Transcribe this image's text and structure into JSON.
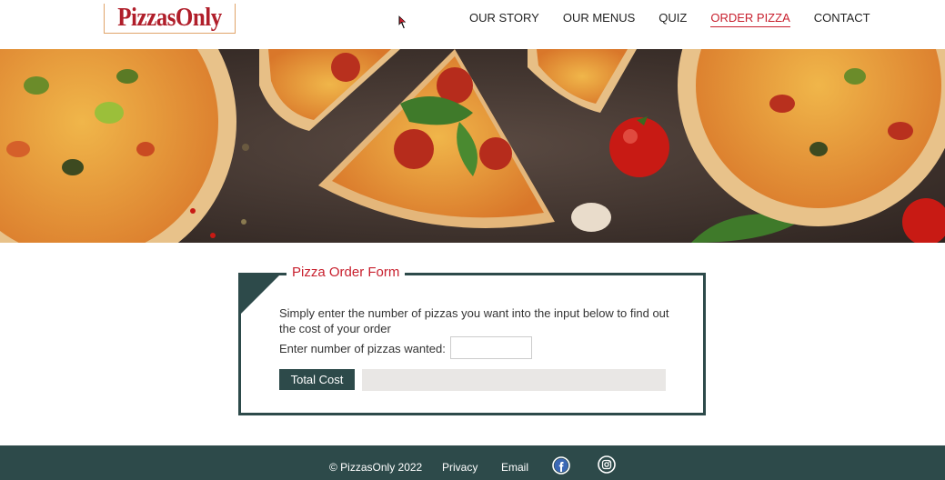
{
  "header": {
    "logo_text": "PizzasOnly",
    "nav": [
      {
        "label": "OUR STORY",
        "active": false
      },
      {
        "label": "OUR MENUS",
        "active": false
      },
      {
        "label": "QUIZ",
        "active": false
      },
      {
        "label": "ORDER PIZZA",
        "active": true
      },
      {
        "label": "CONTACT",
        "active": false
      }
    ]
  },
  "hero": {
    "image": "pizza-slices-hero-image"
  },
  "form": {
    "legend": "Pizza Order Form",
    "description": "Simply enter the number of pizzas you want into the input below to find out the cost of your order",
    "quantity_label": "Enter number of pizzas wanted:",
    "quantity_value": "",
    "total_button": "Total Cost",
    "total_output": ""
  },
  "footer": {
    "copyright": "© PizzasOnly 2022",
    "privacy": "Privacy",
    "email": "Email",
    "social": [
      "facebook-icon",
      "instagram-icon"
    ]
  },
  "colors": {
    "brand_red": "#c8202e",
    "teal_dark": "#2d4a4a",
    "output_bg": "#e9e7e5"
  }
}
